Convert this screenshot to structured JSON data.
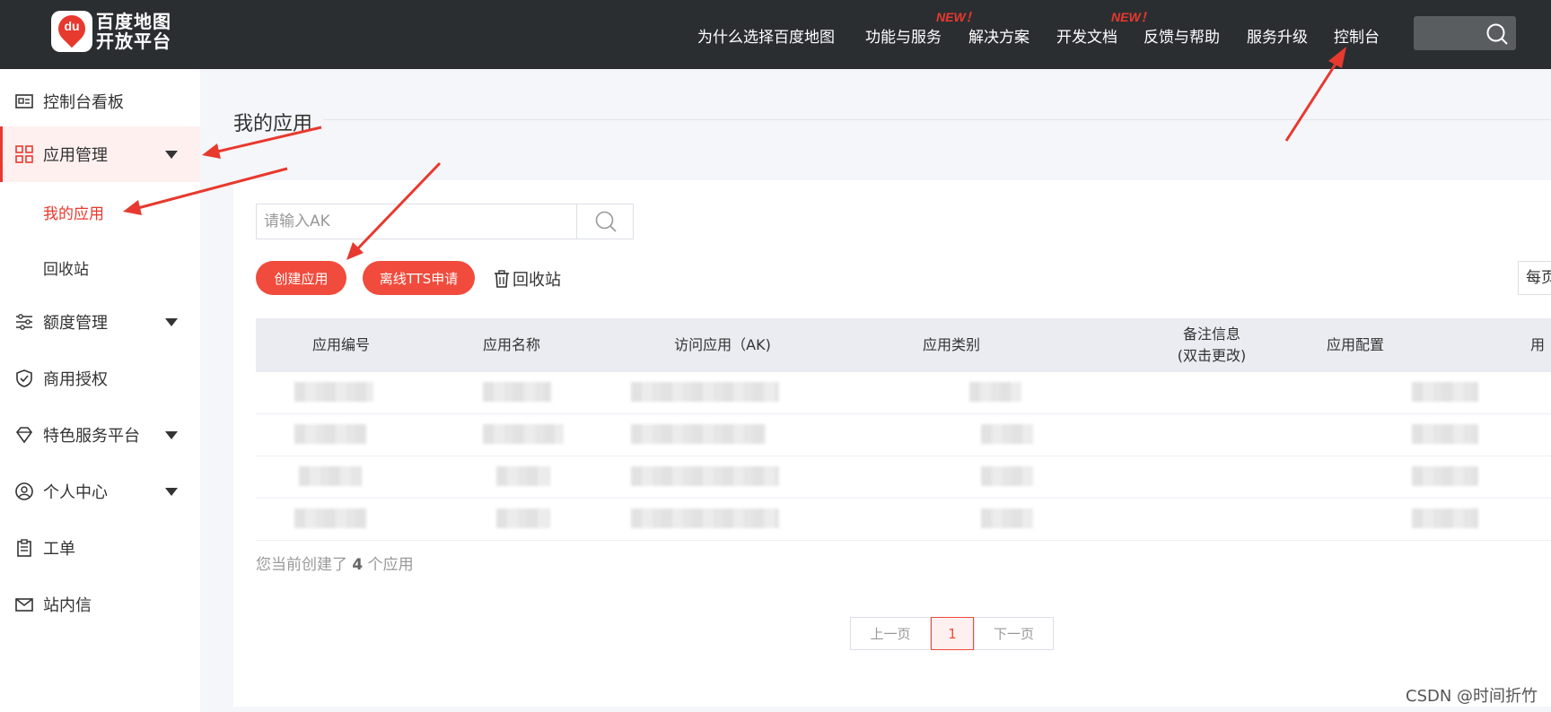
{
  "header": {
    "logo_badge": "du",
    "logo_line1": "百度地图",
    "logo_line2": "开放平台",
    "nav": [
      {
        "label": "为什么选择百度地图",
        "badge": ""
      },
      {
        "label": "功能与服务",
        "badge": "NEW！"
      },
      {
        "label": "解决方案",
        "badge": ""
      },
      {
        "label": "开发文档",
        "badge": "NEW！"
      },
      {
        "label": "反馈与帮助",
        "badge": ""
      },
      {
        "label": "服务升级",
        "badge": ""
      },
      {
        "label": "控制台",
        "badge": ""
      }
    ]
  },
  "sidebar": {
    "items": [
      {
        "label": "控制台看板",
        "icon": "dashboard-card-icon"
      },
      {
        "label": "应用管理",
        "icon": "grid-icon",
        "expanded": true
      },
      {
        "label": "额度管理",
        "icon": "sliders-icon"
      },
      {
        "label": "商用授权",
        "icon": "shield-icon"
      },
      {
        "label": "特色服务平台",
        "icon": "gem-icon"
      },
      {
        "label": "个人中心",
        "icon": "user-circle-icon"
      },
      {
        "label": "工单",
        "icon": "clipboard-icon"
      },
      {
        "label": "站内信",
        "icon": "mail-icon"
      }
    ],
    "sub_items": [
      {
        "label": "我的应用",
        "active": true
      },
      {
        "label": "回收站",
        "active": false
      }
    ]
  },
  "main": {
    "title": "我的应用",
    "search": {
      "placeholder": "请输入AK",
      "value": ""
    },
    "buttons": {
      "create": "创建应用",
      "offline_tts": "离线TTS申请",
      "recycle": "回收站"
    },
    "per_page_label": "每页",
    "table": {
      "headers": [
        "应用编号",
        "应用名称",
        "访问应用（AK)",
        "应用类别",
        "备注信息",
        "(双击更改)",
        "应用配置",
        "用"
      ],
      "row_count": 4
    },
    "summary": {
      "prefix": "您当前创建了",
      "count": "4",
      "suffix": "个应用"
    },
    "pagination": {
      "prev": "上一页",
      "current": "1",
      "next": "下一页"
    }
  },
  "watermark": "CSDN @时间折竹",
  "colors": {
    "accent": "#f04b3c",
    "topbar": "#2b2e31",
    "arrow": "#e8392e"
  }
}
